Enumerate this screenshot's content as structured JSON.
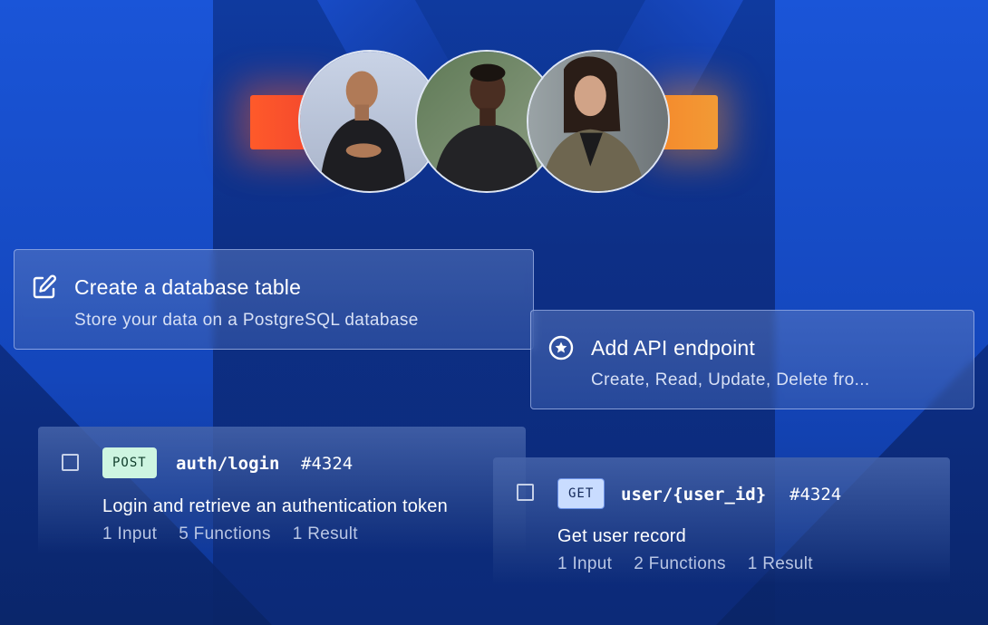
{
  "cards": {
    "database": {
      "title": "Create a database table",
      "subtitle": "Store your data on a PostgreSQL database",
      "icon": "edit-icon"
    },
    "api": {
      "title": "Add API endpoint",
      "subtitle": "Create, Read, Update, Delete fro...",
      "icon": "star-circle-icon"
    }
  },
  "endpoints": [
    {
      "method": "POST",
      "route": "auth/login",
      "ticket": "#4324",
      "description": "Login and retrieve an authentication token",
      "inputs": "1 Input",
      "functions": "5 Functions",
      "results": "1 Result",
      "method_color": "#cdf5e1"
    },
    {
      "method": "GET",
      "route": "user/{user_id}",
      "ticket": "#4324",
      "description": "Get user record",
      "inputs": "1 Input",
      "functions": "2 Functions",
      "results": "1 Result",
      "method_color": "#c9dcff"
    }
  ],
  "colors": {
    "background": "#0f3aa8",
    "glow_left": "#f2462e",
    "glow_right": "#f29a35"
  }
}
